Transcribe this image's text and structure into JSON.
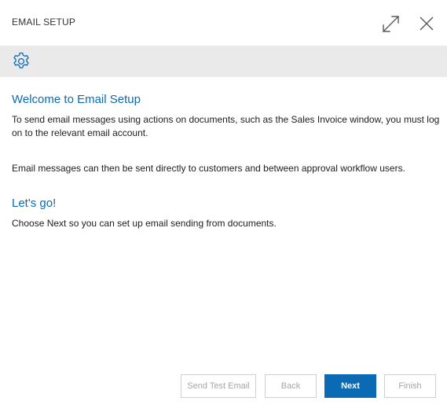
{
  "dialog": {
    "title": "EMAIL SETUP",
    "expand_icon": "expand-icon",
    "close_icon": "close-icon"
  },
  "toolbar": {
    "settings_icon": "gear-icon"
  },
  "content": {
    "welcome_heading": "Welcome to Email Setup",
    "welcome_text_1": "To send email messages using actions on documents, such as the Sales Invoice window, you must log on to the relevant email account.",
    "welcome_text_2": "Email messages can then be sent directly to customers and between approval workflow users.",
    "letsgo_heading": "Let's go!",
    "letsgo_text": "Choose Next so you can set up email sending from documents."
  },
  "buttons": {
    "send_test_email": "Send Test Email",
    "back": "Back",
    "next": "Next",
    "finish": "Finish"
  },
  "colors": {
    "accent": "#0a6ab4",
    "toolbar_bg": "#eaeaea",
    "disabled_text": "#a6a6a6"
  }
}
